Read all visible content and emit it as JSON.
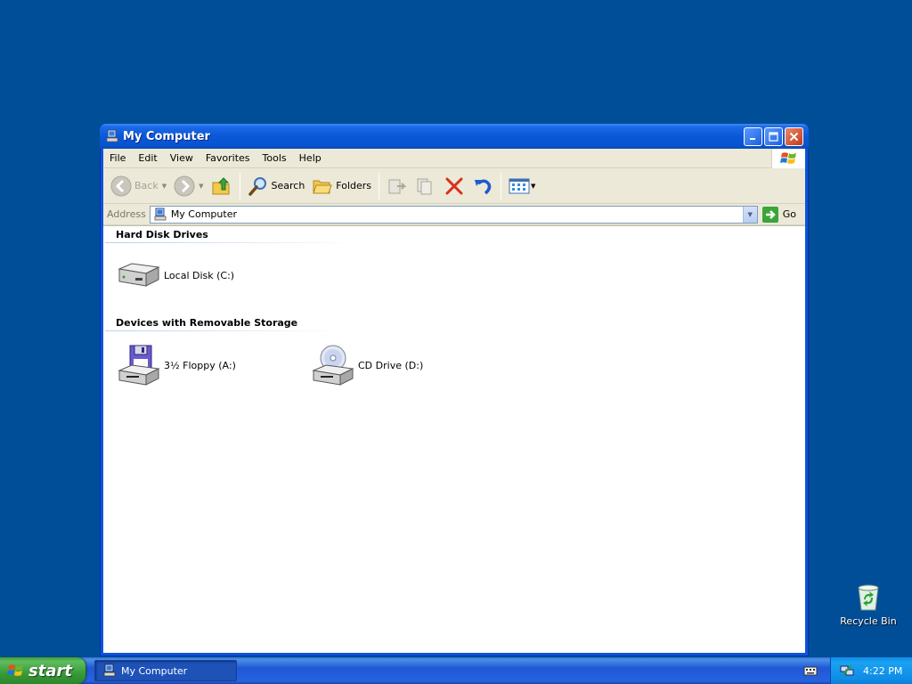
{
  "window": {
    "title": "My Computer"
  },
  "menubar": {
    "items": [
      "File",
      "Edit",
      "View",
      "Favorites",
      "Tools",
      "Help"
    ]
  },
  "toolbar": {
    "back_label": "Back",
    "search_label": "Search",
    "folders_label": "Folders"
  },
  "address": {
    "label": "Address",
    "value": "My Computer",
    "go_label": "Go"
  },
  "content": {
    "groups": [
      {
        "header": "Hard Disk Drives",
        "items": [
          {
            "label": "Local Disk (C:)",
            "icon": "hard-disk-icon"
          }
        ]
      },
      {
        "header": "Devices with Removable Storage",
        "items": [
          {
            "label": "3½ Floppy (A:)",
            "icon": "floppy-drive-icon"
          },
          {
            "label": "CD Drive (D:)",
            "icon": "cd-drive-icon"
          }
        ]
      }
    ]
  },
  "desktop": {
    "recycle_bin_label": "Recycle Bin"
  },
  "taskbar": {
    "start_label": "start",
    "task_label": "My Computer",
    "clock": "4:22 PM"
  },
  "colors": {
    "desktop": "#004e98",
    "titlebar": "#0a58d8",
    "chrome": "#ece9d8"
  }
}
